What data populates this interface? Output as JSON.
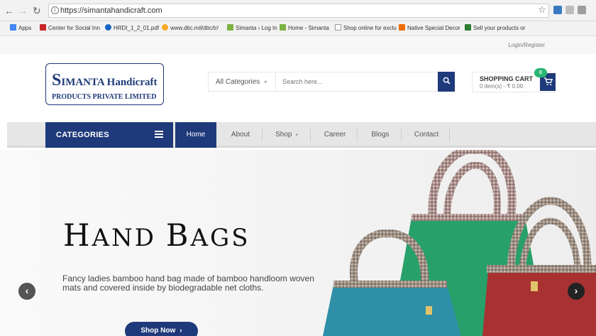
{
  "browser": {
    "url": "https://simantahandicraft.com",
    "bookmarks": [
      "Apps",
      "Center for Social Inn",
      "HRDI_1_2_01.pdf",
      "www.dtic.mil/dtic/tr/",
      "Simanta › Log In",
      "Home - Simanta",
      "Shop online for exclu",
      "Native Special Decor",
      "Sell your products or"
    ]
  },
  "topbar": {
    "login": "Login/Register"
  },
  "logo": {
    "first_letter": "S",
    "line1_rest": "IMANTA Handicraft",
    "line2": "PRODUCTS PRIVATE LIMITED"
  },
  "search": {
    "category": "All Categories",
    "placeholder": "Search here..."
  },
  "cart": {
    "title": "SHOPPING CART",
    "summary": "0 item(s) - ₹ 0.00",
    "badge": "0"
  },
  "nav": {
    "categories_label": "CATEGORIES",
    "items": [
      "Home",
      "About",
      "Shop",
      "Career",
      "Blogs",
      "Contact"
    ]
  },
  "hero": {
    "title_h": "H",
    "title_and": "AND ",
    "title_b": "B",
    "title_ags": "AGS",
    "description": "Fancy ladies bamboo hand bag made of bamboo handloom woven mats and covered inside by biodegradable net cloths.",
    "button": "Shop Now"
  },
  "colors": {
    "brand_blue": "#1f3a7a",
    "badge_green": "#2bb673",
    "bag_teal": "#2e8fa6",
    "bag_green": "#27a06a",
    "bag_red": "#a83232"
  }
}
